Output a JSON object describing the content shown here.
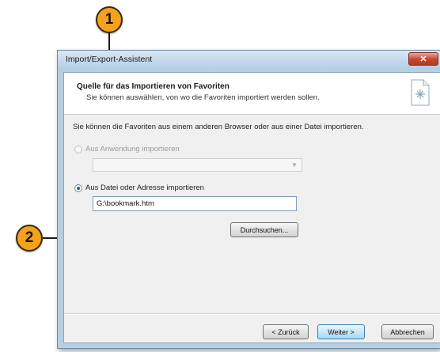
{
  "callouts": {
    "one": "1",
    "two": "2"
  },
  "window": {
    "title": "Import/Export-Assistent",
    "close_label": "✕"
  },
  "header": {
    "title": "Quelle für das Importieren von Favoriten",
    "subtitle": "Sie können auswählen, von wo die Favoriten importiert werden sollen.",
    "icon": "document-star-icon"
  },
  "body": {
    "intro": "Sie können die Favoriten aus einem anderen Browser oder aus einer Datei importieren.",
    "option_app": {
      "label": "Aus Anwendung importieren",
      "checked": false,
      "enabled": false
    },
    "app_select": {
      "value": "",
      "enabled": false
    },
    "option_file": {
      "label": "Aus Datei oder Adresse importieren",
      "checked": true,
      "enabled": true
    },
    "file_path": {
      "value": "G:\\bookmark.htm"
    },
    "browse_label": "Durchsuchen..."
  },
  "footer": {
    "back_label": "< Zurück",
    "next_label": "Weiter >",
    "cancel_label": "Abbrechen"
  },
  "colors": {
    "callout": "#f4a21d",
    "window_frame": "#b7cfe3",
    "close_button": "#c7442d",
    "default_button_border": "#3c7fb1"
  }
}
